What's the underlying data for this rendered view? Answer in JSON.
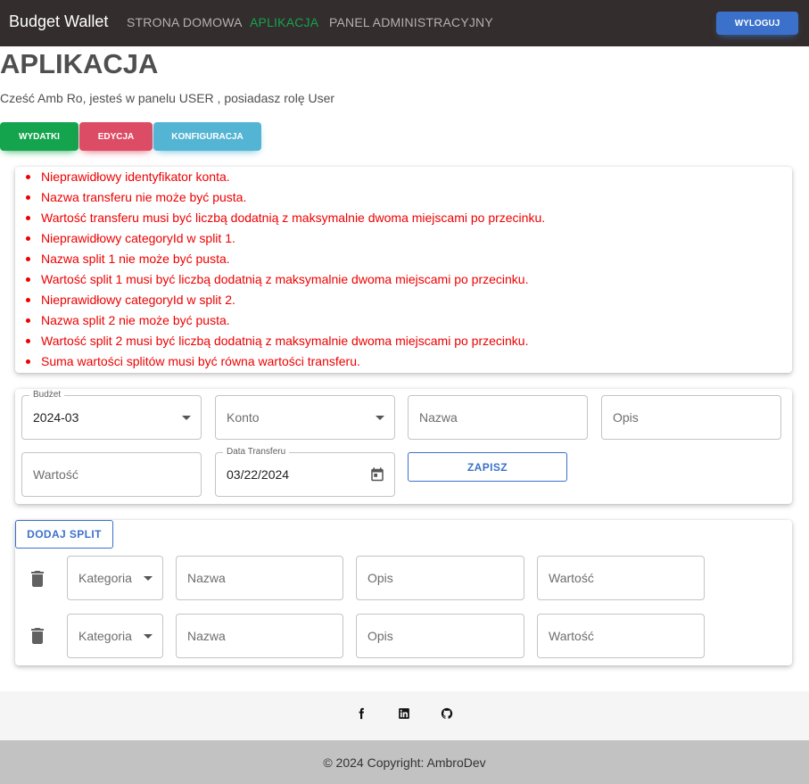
{
  "navbar": {
    "brand": "Budget Wallet",
    "links": [
      "STRONA DOMOWA",
      "APLIKACJA",
      "PANEL ADMINISTRACYJNY"
    ],
    "logout_label": "WYLOGUJ",
    "colors": {
      "background": "#332d2d",
      "active_link": "#14a44d",
      "logout": "#3b71ca"
    }
  },
  "page": {
    "title": "APLIKACJA",
    "greeting": "Cześć Amb Ro, jesteś w panelu USER , posiadasz rolę User"
  },
  "tabs": [
    {
      "label": "WYDATKI",
      "color": "#14a44d"
    },
    {
      "label": "EDYCJA",
      "color": "#dc4c64"
    },
    {
      "label": "KONFIGURACJA",
      "color": "#54b4d3"
    }
  ],
  "errors": [
    "Nieprawidłowy identyfikator konta.",
    "Nazwa transferu nie może być pusta.",
    "Wartość transferu musi być liczbą dodatnią z maksymalnie dwoma miejscami po przecinku.",
    "Nieprawidłowy categoryId w split 1.",
    "Nazwa split 1 nie może być pusta.",
    "Wartość split 1 musi być liczbą dodatnią z maksymalnie dwoma miejscami po przecinku.",
    "Nieprawidłowy categoryId w split 2.",
    "Nazwa split 2 nie może być pusta.",
    "Wartość split 2 musi być liczbą dodatnią z maksymalnie dwoma miejscami po przecinku.",
    "Suma wartości splitów musi być równa wartości transferu."
  ],
  "form": {
    "budget_label": "Budżet",
    "budget_value": "2024-03",
    "account_placeholder": "Konto",
    "name_placeholder": "Nazwa",
    "description_placeholder": "Opis",
    "value_placeholder": "Wartość",
    "date_label": "Data Transferu",
    "date_value": "03/22/2024",
    "save_label": "ZAPISZ"
  },
  "splits": {
    "add_label": "DODAJ SPLIT",
    "rows": [
      {
        "category_placeholder": "Kategoria",
        "name_placeholder": "Nazwa",
        "description_placeholder": "Opis",
        "value_placeholder": "Wartość"
      },
      {
        "category_placeholder": "Kategoria",
        "name_placeholder": "Nazwa",
        "description_placeholder": "Opis",
        "value_placeholder": "Wartość"
      }
    ]
  },
  "footer": {
    "social_icons": [
      "facebook-icon",
      "linkedin-icon",
      "github-icon"
    ],
    "copyright": "© 2024 Copyright: AmbroDev"
  }
}
